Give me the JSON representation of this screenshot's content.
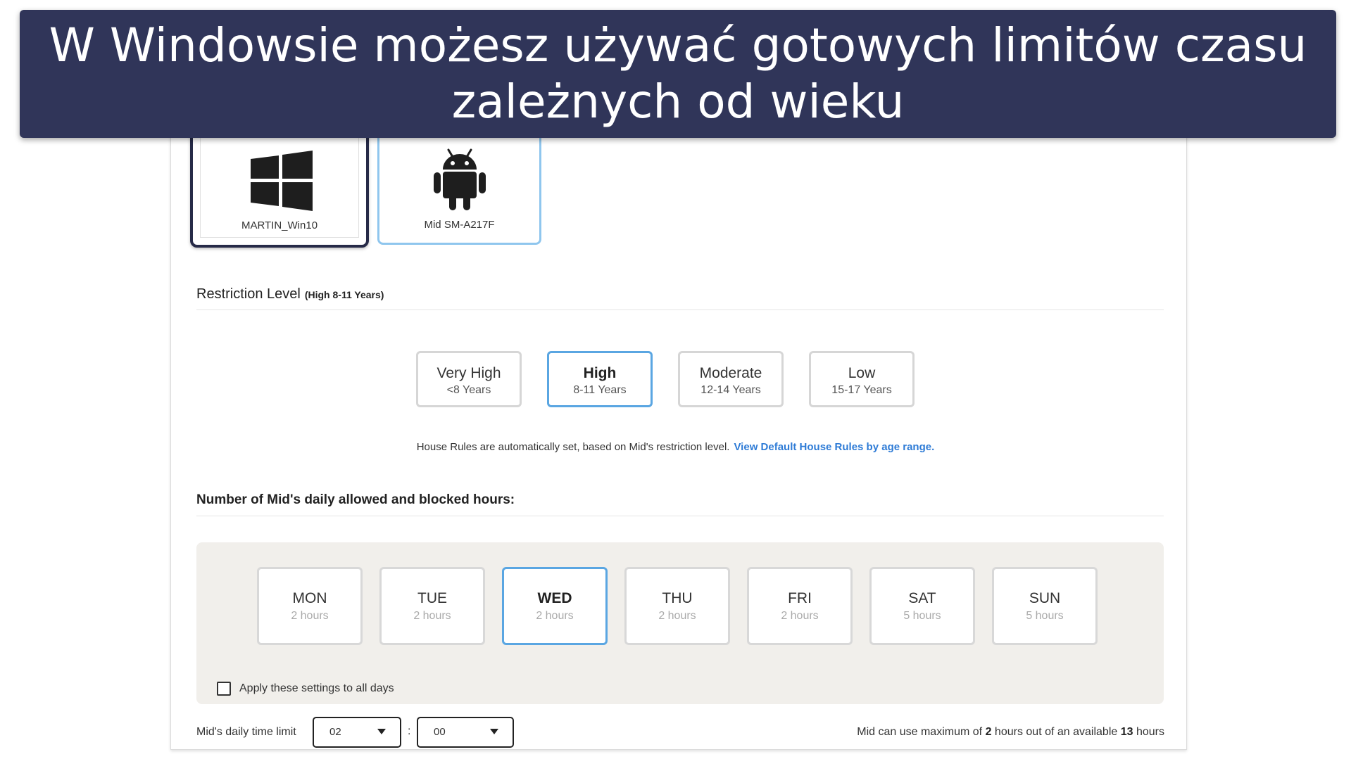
{
  "banner": {
    "line1": "W Windowsie możesz używać gotowych limitów czasu",
    "line2": "zależnych od wieku"
  },
  "devices": [
    {
      "name": "MARTIN_Win10",
      "icon": "windows-icon",
      "selected": true
    },
    {
      "name": "Mid SM-A217F",
      "icon": "android-icon",
      "selected": false
    }
  ],
  "restriction": {
    "title": "Restriction Level",
    "subtitle": "(High 8-11 Years)",
    "levels": [
      {
        "name": "Very High",
        "range": "<8 Years"
      },
      {
        "name": "High",
        "range": "8-11 Years"
      },
      {
        "name": "Moderate",
        "range": "12-14 Years"
      },
      {
        "name": "Low",
        "range": "15-17 Years"
      }
    ],
    "selected": "High",
    "note": "House Rules are automatically set, based on Mid's restriction level.",
    "link": "View Default House Rules by age range."
  },
  "hours": {
    "title": "Number of Mid's daily allowed and blocked hours:",
    "days": [
      {
        "name": "MON",
        "hours": "2 hours"
      },
      {
        "name": "TUE",
        "hours": "2 hours"
      },
      {
        "name": "WED",
        "hours": "2 hours"
      },
      {
        "name": "THU",
        "hours": "2 hours"
      },
      {
        "name": "FRI",
        "hours": "2 hours"
      },
      {
        "name": "SAT",
        "hours": "5 hours"
      },
      {
        "name": "SUN",
        "hours": "5 hours"
      }
    ],
    "selected_day": "WED",
    "apply_all_label": "Apply these settings to all days",
    "apply_all_checked": false
  },
  "time_limit": {
    "label": "Mid's daily time limit",
    "hours_value": "02",
    "separator": ":",
    "minutes_value": "00",
    "summary_prefix": "Mid can use maximum of",
    "summary_hours": "2",
    "summary_mid": "hours out of an available",
    "summary_available": "13",
    "summary_suffix": "hours"
  },
  "colors": {
    "banner_bg": "#303559",
    "selected_border": "#5aa6e2",
    "link": "#2e7bd6",
    "days_bg": "#f1efeb"
  }
}
